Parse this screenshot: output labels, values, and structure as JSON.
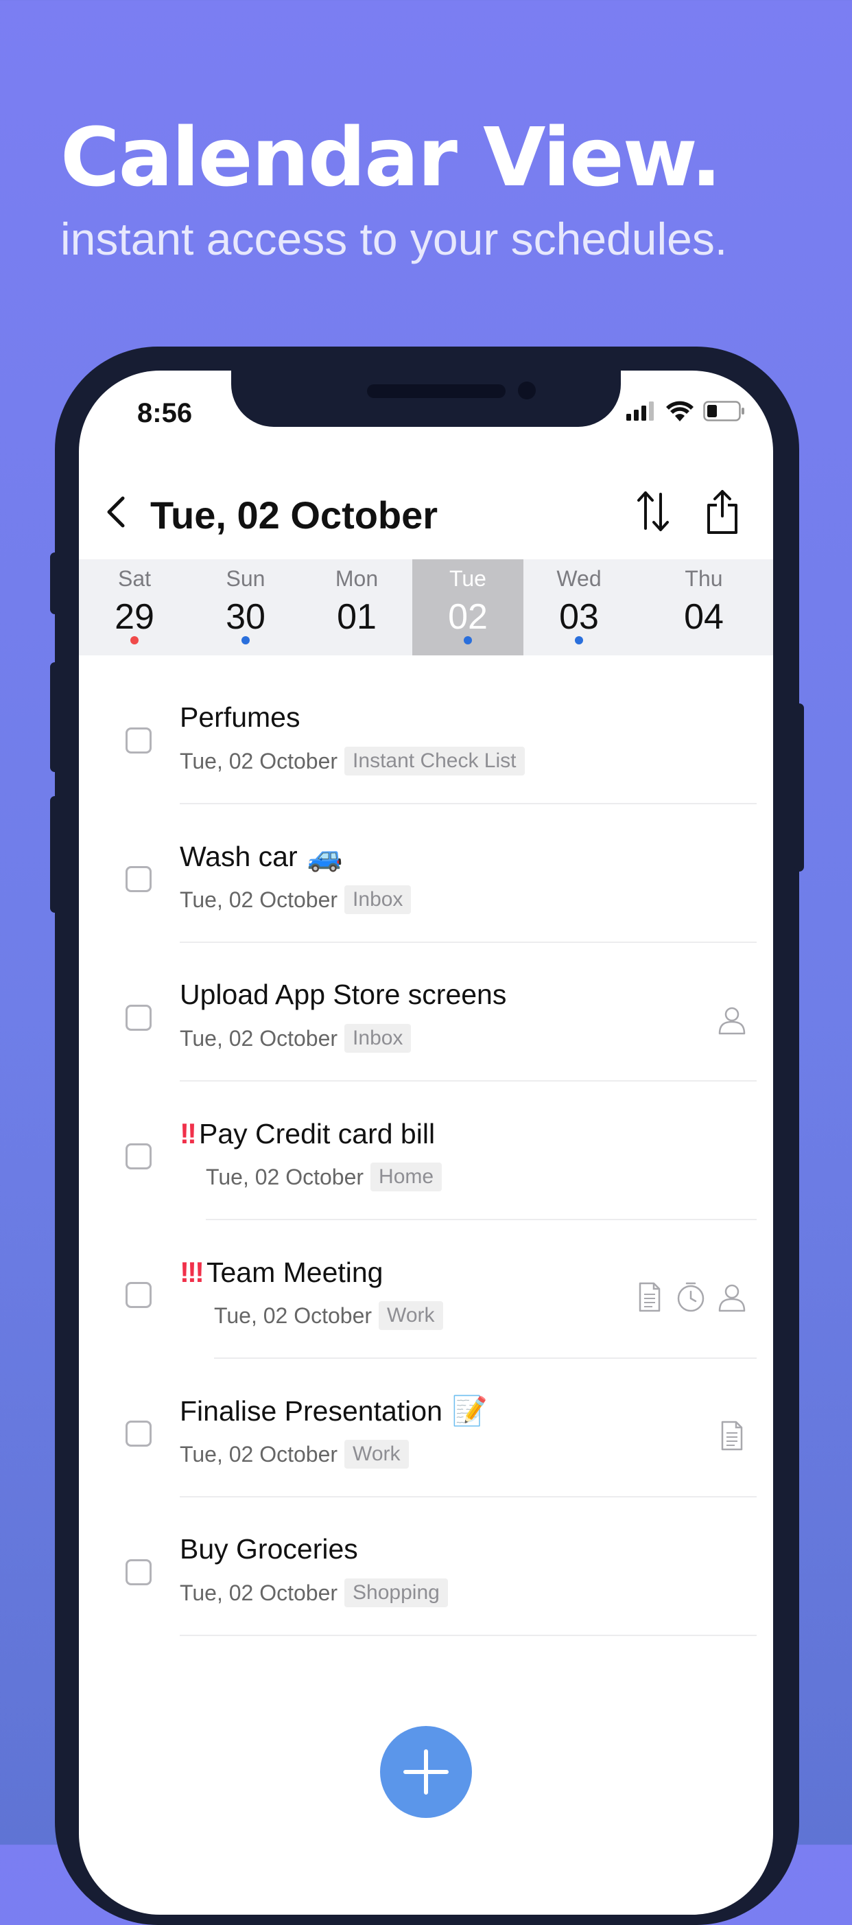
{
  "marketing": {
    "headline": "Calendar View.",
    "subheadline": "instant access to your schedules."
  },
  "status_bar": {
    "time": "8:56",
    "icons": [
      "cellular-signal-icon",
      "wifi-icon",
      "battery-icon"
    ]
  },
  "nav": {
    "title": "Tue, 02 October",
    "icons": [
      "back-chevron-icon",
      "sort-icon",
      "share-icon"
    ]
  },
  "week": [
    {
      "name": "Sat",
      "num": "29",
      "dot": "#f04a4a",
      "selected": false
    },
    {
      "name": "Sun",
      "num": "30",
      "dot": "#2a6fdc",
      "selected": false
    },
    {
      "name": "Mon",
      "num": "01",
      "dot": null,
      "selected": false
    },
    {
      "name": "Tue",
      "num": "02",
      "dot": "#2a6fdc",
      "selected": true
    },
    {
      "name": "Wed",
      "num": "03",
      "dot": "#2a6fdc",
      "selected": false
    },
    {
      "name": "Thu",
      "num": "04",
      "dot": null,
      "selected": false
    }
  ],
  "tasks": [
    {
      "priority": "",
      "title": "Perfumes",
      "emoji": "",
      "date": "Tue, 02 October",
      "tag": "Instant Check List",
      "icons": []
    },
    {
      "priority": "",
      "title": "Wash car",
      "emoji": "🚙",
      "date": "Tue, 02 October",
      "tag": "Inbox",
      "icons": []
    },
    {
      "priority": "",
      "title": "Upload App Store screens",
      "emoji": "",
      "date": "Tue, 02 October",
      "tag": "Inbox",
      "icons": [
        "person-icon"
      ]
    },
    {
      "priority": "!!",
      "title": "Pay Credit card bill",
      "emoji": "",
      "date": "Tue, 02 October",
      "tag": "Home",
      "icons": []
    },
    {
      "priority": "!!!",
      "title": "Team Meeting",
      "emoji": "",
      "date": "Tue, 02 October",
      "tag": "Work",
      "icons": [
        "note-icon",
        "reminder-clock-icon",
        "person-icon"
      ]
    },
    {
      "priority": "",
      "title": "Finalise Presentation",
      "emoji": "📝",
      "date": "Tue, 02 October",
      "tag": "Work",
      "icons": [
        "note-icon"
      ]
    },
    {
      "priority": "",
      "title": "Buy Groceries",
      "emoji": "",
      "date": "Tue, 02 October",
      "tag": "Shopping",
      "icons": []
    }
  ],
  "fab": {
    "icon": "plus-icon",
    "color": "#5b96ea"
  },
  "colors": {
    "priority": "#f0304a",
    "accent_dot": "#2a6fdc",
    "selected_day_bg": "#c3c3c6"
  }
}
